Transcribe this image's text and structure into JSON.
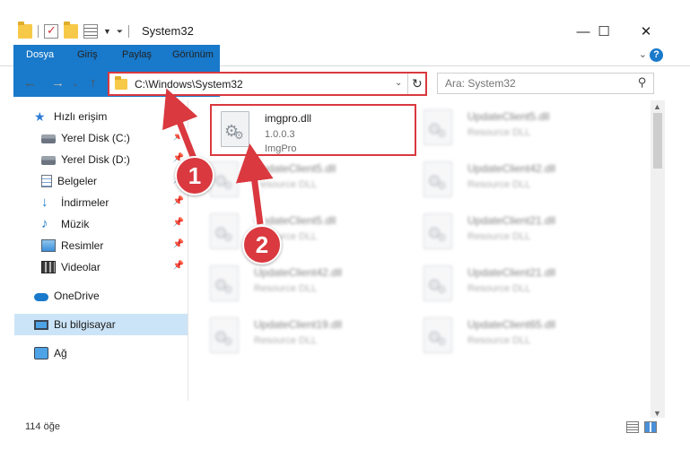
{
  "window": {
    "title": "System32",
    "minimize": "—",
    "maximize": "☐",
    "close": "✕"
  },
  "ribbon": {
    "tabs": [
      "Dosya",
      "Giriş",
      "Paylaş",
      "Görünüm"
    ]
  },
  "address": {
    "path": "C:\\Windows\\System32"
  },
  "search": {
    "placeholder": "Ara: System32"
  },
  "nav": {
    "items": [
      {
        "label": "Hızlı erişim",
        "icon": "star-icon"
      },
      {
        "label": "Yerel Disk (C:)",
        "icon": "disk-icon",
        "pinned": true
      },
      {
        "label": "Yerel Disk (D:)",
        "icon": "disk-icon",
        "pinned": true
      },
      {
        "label": "Belgeler",
        "icon": "documents-icon",
        "pinned": true
      },
      {
        "label": "İndirmeler",
        "icon": "download-icon",
        "pinned": true
      },
      {
        "label": "Müzik",
        "icon": "music-icon",
        "pinned": true
      },
      {
        "label": "Resimler",
        "icon": "pictures-icon",
        "pinned": true
      },
      {
        "label": "Videolar",
        "icon": "videos-icon",
        "pinned": true
      },
      {
        "label": "OneDrive",
        "icon": "onedrive-icon"
      },
      {
        "label": "Bu bilgisayar",
        "icon": "computer-icon",
        "selected": true
      },
      {
        "label": "Ağ",
        "icon": "network-icon"
      }
    ]
  },
  "files": [
    {
      "name": "imgpro.dll",
      "line2": "1.0.0.3",
      "line3": "ImgPro",
      "highlighted": true
    },
    {
      "name": "UpdateClient5.dll",
      "line2": "Resource DLL",
      "blurred": true
    },
    {
      "name": "UpdateClient5.dll",
      "line2": "Resource DLL",
      "blurred": true
    },
    {
      "name": "UpdateClient42.dll",
      "line2": "Resource DLL",
      "blurred": true
    },
    {
      "name": "UpdateClient5.dll",
      "line2": "Resource DLL",
      "blurred": true
    },
    {
      "name": "UpdateClient21.dll",
      "line2": "Resource DLL",
      "blurred": true
    },
    {
      "name": "UpdateClient42.dll",
      "line2": "Resource DLL",
      "blurred": true
    },
    {
      "name": "UpdateClient21.dll",
      "line2": "Resource DLL",
      "blurred": true
    },
    {
      "name": "UpdateClient19.dll",
      "line2": "Resource DLL",
      "blurred": true
    },
    {
      "name": "UpdateClient65.dll",
      "line2": "Resource DLL",
      "blurred": true
    }
  ],
  "status": {
    "count": "114 öğe"
  },
  "callouts": [
    {
      "label": "1"
    },
    {
      "label": "2"
    }
  ],
  "colors": {
    "accent": "#1979ca",
    "highlight": "#d9393f",
    "selected_bg": "#cce4f7"
  }
}
